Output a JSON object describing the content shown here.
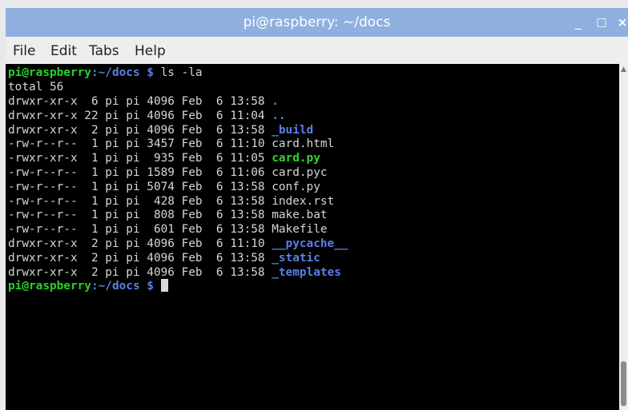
{
  "window": {
    "title": "pi@raspberry: ~/docs",
    "controls": {
      "minimize": "_",
      "maximize": "□",
      "close": "×"
    }
  },
  "menu": {
    "items": [
      "File",
      "Edit",
      "Tabs",
      "Help"
    ]
  },
  "terminal": {
    "prompt_user": "pi@raspberry",
    "prompt_path": ":~/docs $",
    "command": " ls -la",
    "total": "total 56",
    "entries": [
      {
        "meta": "drwxr-xr-x  6 pi pi 4096 Feb  6 13:58 ",
        "name": ".",
        "kind": "dir"
      },
      {
        "meta": "drwxr-xr-x 22 pi pi 4096 Feb  6 11:04 ",
        "name": "..",
        "kind": "dir"
      },
      {
        "meta": "drwxr-xr-x  2 pi pi 4096 Feb  6 13:58 ",
        "name": "_build",
        "kind": "dir"
      },
      {
        "meta": "-rw-r--r--  1 pi pi 3457 Feb  6 11:10 ",
        "name": "card.html",
        "kind": "file"
      },
      {
        "meta": "-rwxr-xr-x  1 pi pi  935 Feb  6 11:05 ",
        "name": "card.py",
        "kind": "exe"
      },
      {
        "meta": "-rw-r--r--  1 pi pi 1589 Feb  6 11:06 ",
        "name": "card.pyc",
        "kind": "file"
      },
      {
        "meta": "-rw-r--r--  1 pi pi 5074 Feb  6 13:58 ",
        "name": "conf.py",
        "kind": "file"
      },
      {
        "meta": "-rw-r--r--  1 pi pi  428 Feb  6 13:58 ",
        "name": "index.rst",
        "kind": "file"
      },
      {
        "meta": "-rw-r--r--  1 pi pi  808 Feb  6 13:58 ",
        "name": "make.bat",
        "kind": "file"
      },
      {
        "meta": "-rw-r--r--  1 pi pi  601 Feb  6 13:58 ",
        "name": "Makefile",
        "kind": "file"
      },
      {
        "meta": "drwxr-xr-x  2 pi pi 4096 Feb  6 11:10 ",
        "name": "__pycache__",
        "kind": "dir"
      },
      {
        "meta": "drwxr-xr-x  2 pi pi 4096 Feb  6 13:58 ",
        "name": "_static",
        "kind": "dir"
      },
      {
        "meta": "drwxr-xr-x  2 pi pi 4096 Feb  6 13:58 ",
        "name": "_templates",
        "kind": "dir"
      }
    ]
  },
  "colors": {
    "titlebar": "#8fb0df",
    "prompt_user": "#27d22a",
    "prompt_path": "#5d7fe3",
    "directory": "#5b7ee8",
    "executable": "#31d62e",
    "text": "#d6d6d6",
    "background": "#000000"
  }
}
